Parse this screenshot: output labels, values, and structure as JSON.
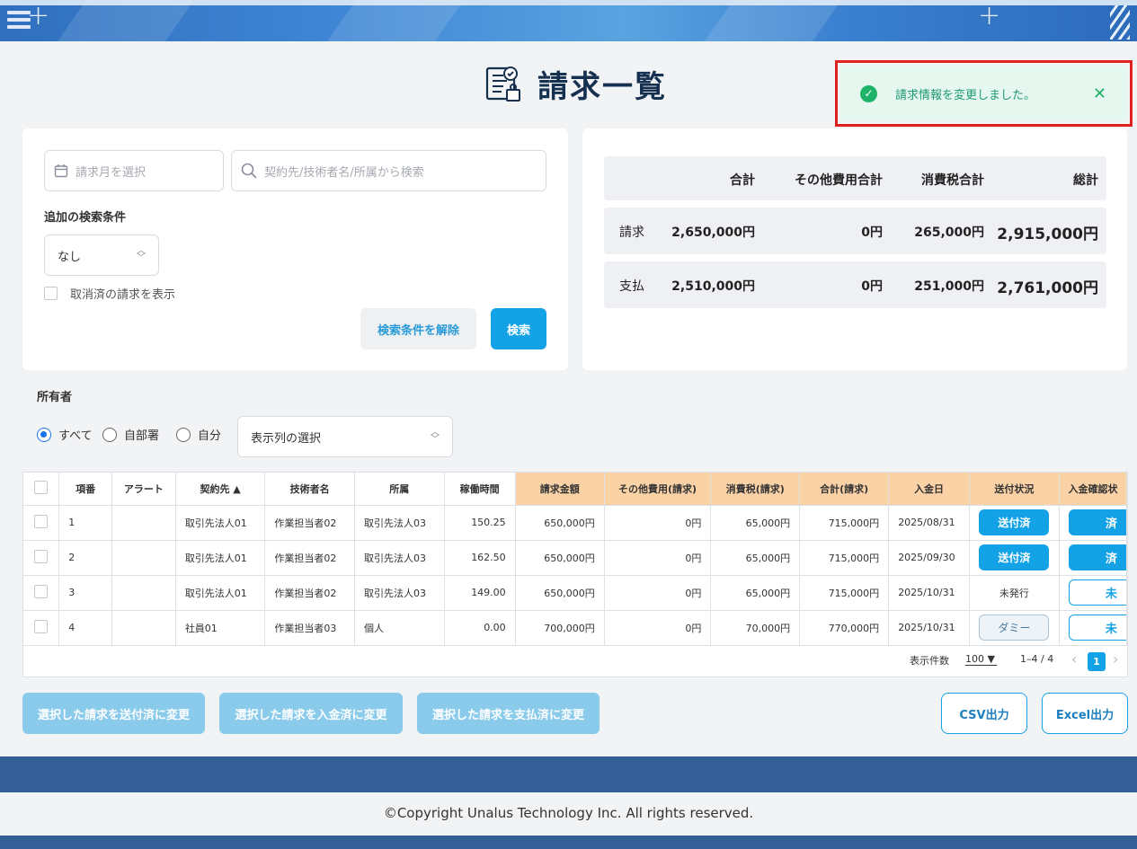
{
  "header": {
    "icons": [
      "menu-icon",
      "hatch-pattern-icon"
    ]
  },
  "page": {
    "title": "請求一覧",
    "title_icon": "invoice-document-icon"
  },
  "toast": {
    "message": "請求情報を変更しました。",
    "close": "✕",
    "accent_color": "#1fb36a",
    "highlight_color": "#e0201f"
  },
  "search": {
    "month_placeholder": "請求月を選択",
    "keyword_placeholder": "契約先/技術者名/所属から検索",
    "extra_label": "追加の検索条件",
    "extra_value": "なし",
    "show_cancelled_label": "取消済の請求を表示",
    "clear_label": "検索条件を解除",
    "search_label": "検索"
  },
  "summary": {
    "headers": [
      "合計",
      "その他費用合計",
      "消費税合計",
      "総計"
    ],
    "rows": [
      {
        "label": "請求",
        "total": "2,650,000円",
        "other": "0円",
        "tax": "265,000円",
        "grand": "2,915,000円"
      },
      {
        "label": "支払",
        "total": "2,510,000円",
        "other": "0円",
        "tax": "251,000円",
        "grand": "2,761,000円"
      }
    ]
  },
  "owner": {
    "label": "所有者",
    "options": [
      "すべて",
      "自部署",
      "自分"
    ],
    "selected": "すべて",
    "column_select": "表示列の選択"
  },
  "table": {
    "columns": [
      "項番",
      "アラート",
      "契約先 ▲",
      "技術者名",
      "所属",
      "稼働時間",
      "請求金額",
      "その他費用(請求)",
      "消費税(請求)",
      "合計(請求)",
      "入金日",
      "送付状況",
      "入金確認状"
    ],
    "rows": [
      {
        "no": "1",
        "alert": "",
        "client": "取引先法人01",
        "engineer": "作業担当者02",
        "affiliation": "取引先法人03",
        "hours": "150.25",
        "amount": "650,000円",
        "other": "0円",
        "tax": "65,000円",
        "total": "715,000円",
        "paid_date": "2025/08/31",
        "send_status": "送付済",
        "payment": "済"
      },
      {
        "no": "2",
        "alert": "",
        "client": "取引先法人01",
        "engineer": "作業担当者02",
        "affiliation": "取引先法人03",
        "hours": "162.50",
        "amount": "650,000円",
        "other": "0円",
        "tax": "65,000円",
        "total": "715,000円",
        "paid_date": "2025/09/30",
        "send_status": "送付済",
        "payment": "済"
      },
      {
        "no": "3",
        "alert": "",
        "client": "取引先法人01",
        "engineer": "作業担当者02",
        "affiliation": "取引先法人03",
        "hours": "149.00",
        "amount": "650,000円",
        "other": "0円",
        "tax": "65,000円",
        "total": "715,000円",
        "paid_date": "2025/10/31",
        "send_status": "未発行",
        "payment": "未"
      },
      {
        "no": "4",
        "alert": "",
        "client": "社員01",
        "engineer": "作業担当者03",
        "affiliation": "個人",
        "hours": "0.00",
        "amount": "700,000円",
        "other": "0円",
        "tax": "70,000円",
        "total": "770,000円",
        "paid_date": "2025/10/31",
        "send_status": "ダミー",
        "payment": "未"
      }
    ]
  },
  "pagination": {
    "per_page_label": "表示件数",
    "per_page": "100",
    "range": "1–4 / 4",
    "current_page": "1",
    "prev": "‹",
    "next": "›"
  },
  "actions": {
    "mark_sent": "選択した請求を送付済に変更",
    "mark_received": "選択した請求を入金済に変更",
    "mark_paid": "選択した請求を支払済に変更",
    "csv": "CSV出力",
    "excel": "Excel出力"
  },
  "footer": {
    "copyright": "©Copyright Unalus Technology Inc. All rights reserved."
  },
  "colors": {
    "primary": "#13a2e6",
    "header_blue": "#2f6fbe",
    "footer_blue": "#355e97",
    "money_header": "#fad2a6"
  }
}
